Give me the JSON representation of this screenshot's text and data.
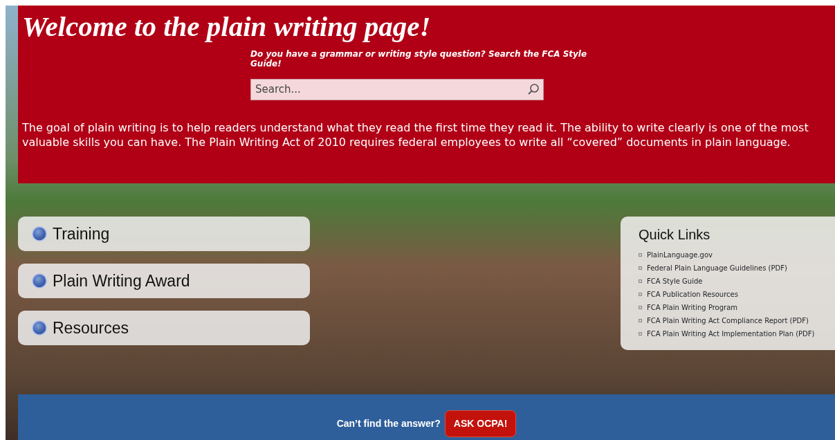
{
  "header": {
    "title": "Welcome to the plain writing page!",
    "prompt": "Do you have a grammar or writing style question? Search the FCA Style Guide!",
    "search": {
      "placeholder": "Search..."
    },
    "intro": "The goal of plain writing is to help readers understand what they read the first time they read it. The ability to write clearly is one of the most valuable skills you can have. The Plain Writing Act of 2010 requires federal employees to write all “covered” documents in plain language."
  },
  "nav_buttons": [
    {
      "label": "Training"
    },
    {
      "label": "Plain Writing Award"
    },
    {
      "label": "Resources"
    }
  ],
  "quick_links": {
    "title": "Quick Links",
    "items": [
      "PlainLanguage.gov",
      "Federal Plain Language Guidelines (PDF)",
      "FCA Style Guide",
      "FCA Publication Resources",
      "FCA Plain Writing Program",
      "FCA Plain Writing Act Compliance Report (PDF)",
      "FCA Plain Writing Act Implementation Plan (PDF)"
    ]
  },
  "footer": {
    "text": "Can’t find the answer?",
    "button": "ASK OCPA!"
  }
}
